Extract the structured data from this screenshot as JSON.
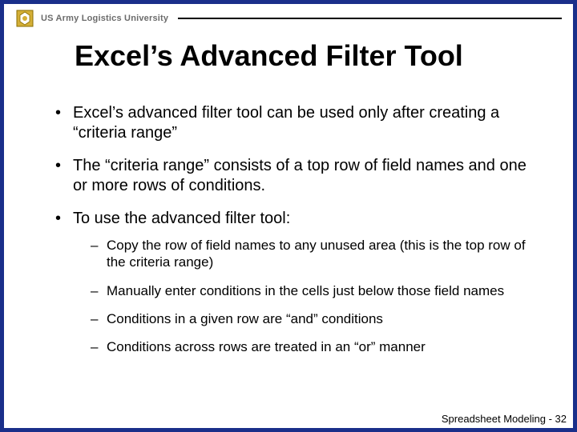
{
  "header": {
    "org": "US Army Logistics University"
  },
  "title": "Excel’s Advanced Filter Tool",
  "bullets": [
    {
      "text": "Excel’s advanced filter tool can be used only after creating a “criteria range”"
    },
    {
      "text": "The “criteria range” consists of a top row of field names and one or more rows of conditions."
    },
    {
      "text": "To use the advanced filter tool:",
      "sub": [
        "Copy the row of field names to any unused area (this is the top row of the criteria range)",
        "Manually enter conditions in the cells just below those field names",
        "Conditions in a given row are “and” conditions",
        "Conditions across rows are treated in an “or” manner"
      ]
    }
  ],
  "footer": "Spreadsheet Modeling - 32"
}
